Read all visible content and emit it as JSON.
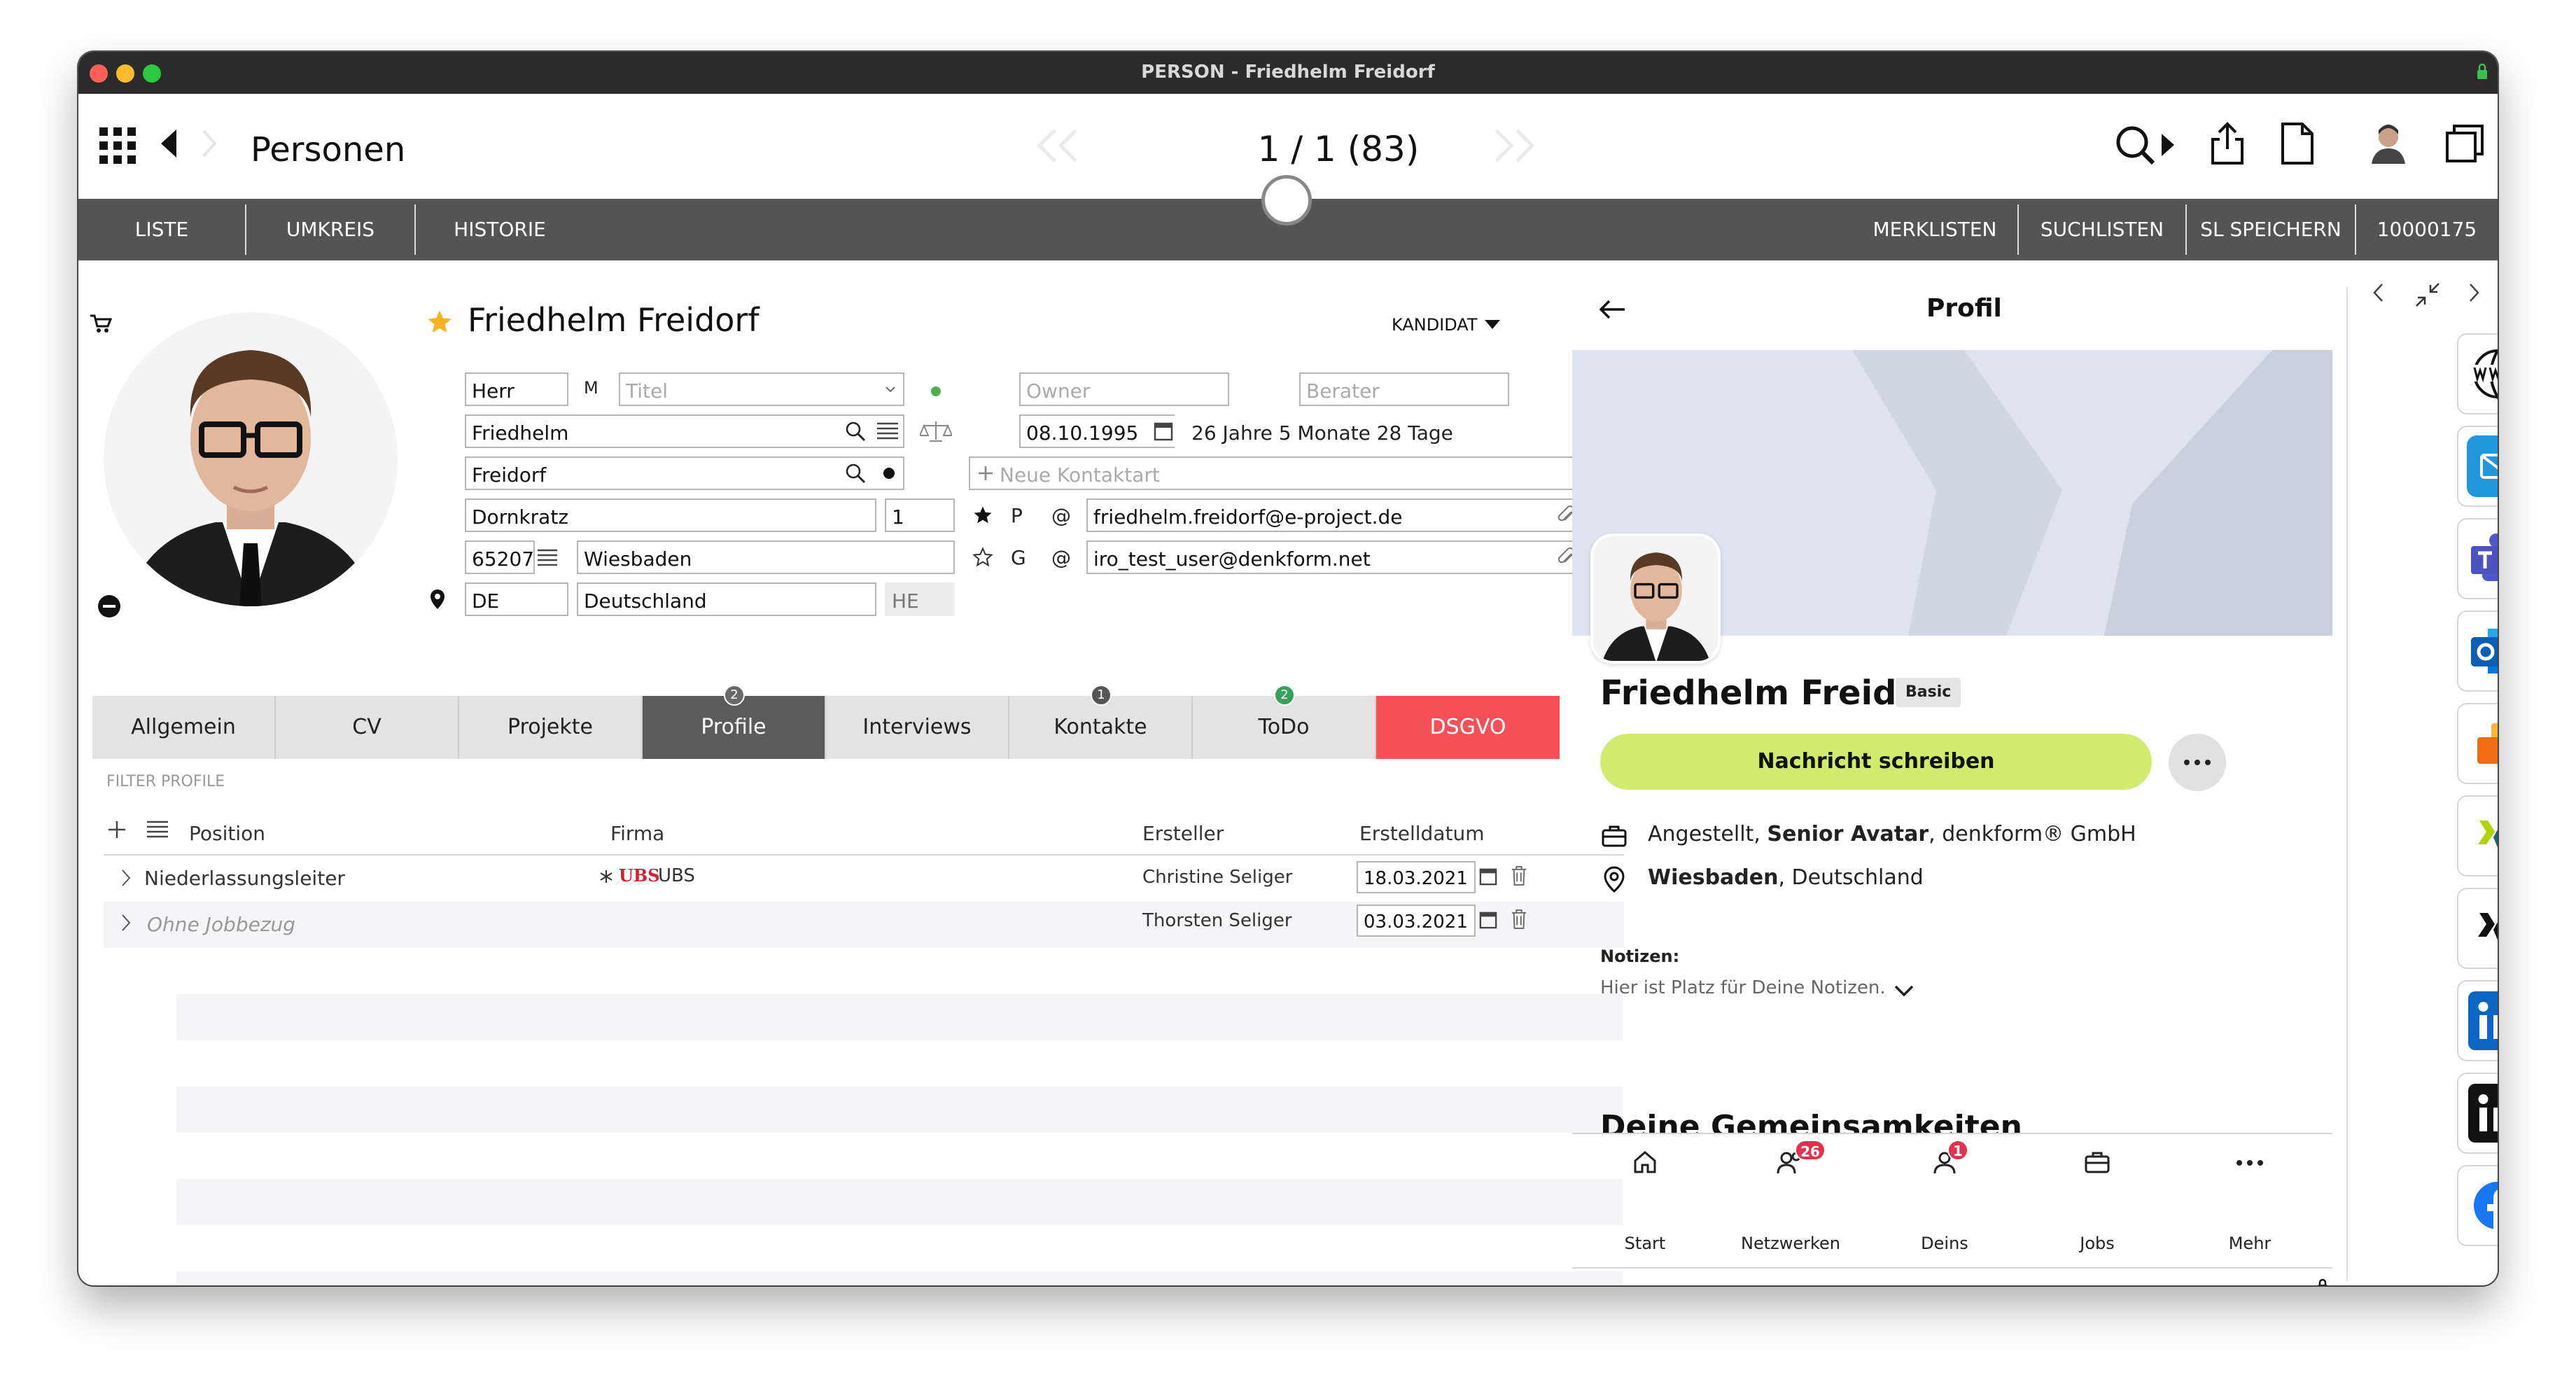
{
  "window": {
    "title": "PERSON - Friedhelm Freidorf"
  },
  "toolbar": {
    "section_title": "Personen",
    "record_counter": "1 / 1  (83)"
  },
  "navbar": {
    "left": [
      "LISTE",
      "UMKREIS",
      "HISTORIE"
    ],
    "right": [
      "MERKLISTEN",
      "SUCHLISTEN",
      "SL SPEICHERN",
      "10000175"
    ]
  },
  "person": {
    "name": "Friedhelm Freidorf",
    "status": "KANDIDAT",
    "salutation": "Herr",
    "gender": "M",
    "title_placeholder": "Titel",
    "owner_placeholder": "Owner",
    "berater_placeholder": "Berater",
    "first_name": "Friedhelm",
    "last_name": "Freidorf",
    "street": "Dornkratz",
    "house_number": "1",
    "zip": "65207",
    "city": "Wiesbaden",
    "country_code": "DE",
    "country": "Deutschland",
    "state": "HE",
    "birth_date": "08.10.1995",
    "age": "26 Jahre 5 Monate 28 Tage",
    "new_contact_placeholder": "Neue Kontaktart",
    "contact_count": "2",
    "contacts": [
      {
        "type": "P",
        "symbol": "@",
        "value": "friedhelm.freidorf@e-project.de"
      },
      {
        "type": "G",
        "symbol": "@",
        "value": "iro_test_user@denkform.net"
      }
    ]
  },
  "tabs": [
    {
      "label": "Allgemein",
      "badge": ""
    },
    {
      "label": "CV",
      "badge": ""
    },
    {
      "label": "Projekte",
      "badge": ""
    },
    {
      "label": "Profile",
      "badge": "2"
    },
    {
      "label": "Interviews",
      "badge": ""
    },
    {
      "label": "Kontakte",
      "badge": "1"
    },
    {
      "label": "ToDo",
      "badge": "2"
    },
    {
      "label": "DSGVO",
      "badge": ""
    }
  ],
  "profiles": {
    "filter_label": "FILTER PROFILE",
    "columns": [
      "Position",
      "Firma",
      "Ersteller",
      "Erstelldatum"
    ],
    "rows": [
      {
        "position": "Niederlassungsleiter",
        "firm_logo": "UBS",
        "firm": "UBS",
        "creator": "Christine Seliger",
        "date": "18.03.2021"
      },
      {
        "position": "Ohne Jobbezug",
        "firm_logo": "",
        "firm": "",
        "creator": "Thorsten Seliger",
        "date": "03.03.2021"
      }
    ]
  },
  "profile_panel": {
    "header": "Profil",
    "name": "Friedhelm Freidorf",
    "tier": "Basic",
    "message_button": "Nachricht schreiben",
    "job_prefix": "Angestellt, ",
    "job_title": "Senior Avatar",
    "job_suffix": ", denkform® GmbH",
    "city": "Wiesbaden",
    "country_suffix": ", Deutschland",
    "notes_label": "Notizen:",
    "notes_placeholder": "Hier ist Platz für Deine Notizen.",
    "section_cut": "Deine Gemeinsamkeiten",
    "bottom_nav": [
      {
        "label": "Start",
        "badge": ""
      },
      {
        "label": "Netzwerken",
        "badge": "26"
      },
      {
        "label": "Deins",
        "badge": "1"
      },
      {
        "label": "Jobs",
        "badge": ""
      },
      {
        "label": "Mehr",
        "badge": ""
      }
    ]
  },
  "colors": {
    "accent_star": "#f5b324",
    "nav_bg": "#545454",
    "dsgvo_red": "#f55057",
    "message_green": "#d0ec6e",
    "badge_red": "#e2314d"
  }
}
